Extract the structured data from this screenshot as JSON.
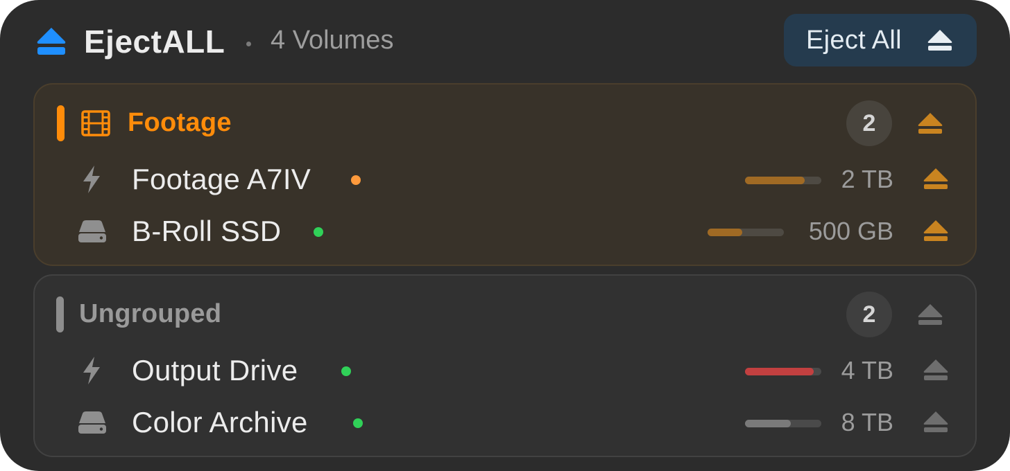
{
  "app": {
    "title": "EjectALL",
    "volume_count": "4 Volumes",
    "icon": "eject-icon",
    "accent_color": "#1f8fff"
  },
  "eject_all_button": {
    "label": "Eject All",
    "icon": "eject-icon"
  },
  "groups": [
    {
      "name": "Footage",
      "icon": "film-icon",
      "color": "#ff8c0a",
      "count": "2",
      "volumes": [
        {
          "name": "Footage A7IV",
          "icon": "bolt-icon",
          "status_color": "#ff9a3c",
          "size": "2 TB",
          "usage": 0.78,
          "bar_color": "#a06a24"
        },
        {
          "name": "B-Roll SSD",
          "icon": "drive-icon",
          "status_color": "#30d158",
          "size": "500 GB",
          "usage": 0.45,
          "bar_color": "#a06a24"
        }
      ]
    },
    {
      "name": "Ungrouped",
      "icon": "",
      "color": "#8e8e8e",
      "count": "2",
      "volumes": [
        {
          "name": "Output Drive",
          "icon": "bolt-icon",
          "status_color": "#30d158",
          "size": "4 TB",
          "usage": 0.9,
          "bar_color": "#c24040"
        },
        {
          "name": "Color Archive",
          "icon": "drive-icon",
          "status_color": "#30d158",
          "size": "8 TB",
          "usage": 0.6,
          "bar_color": "#7a7a7a"
        }
      ]
    }
  ]
}
